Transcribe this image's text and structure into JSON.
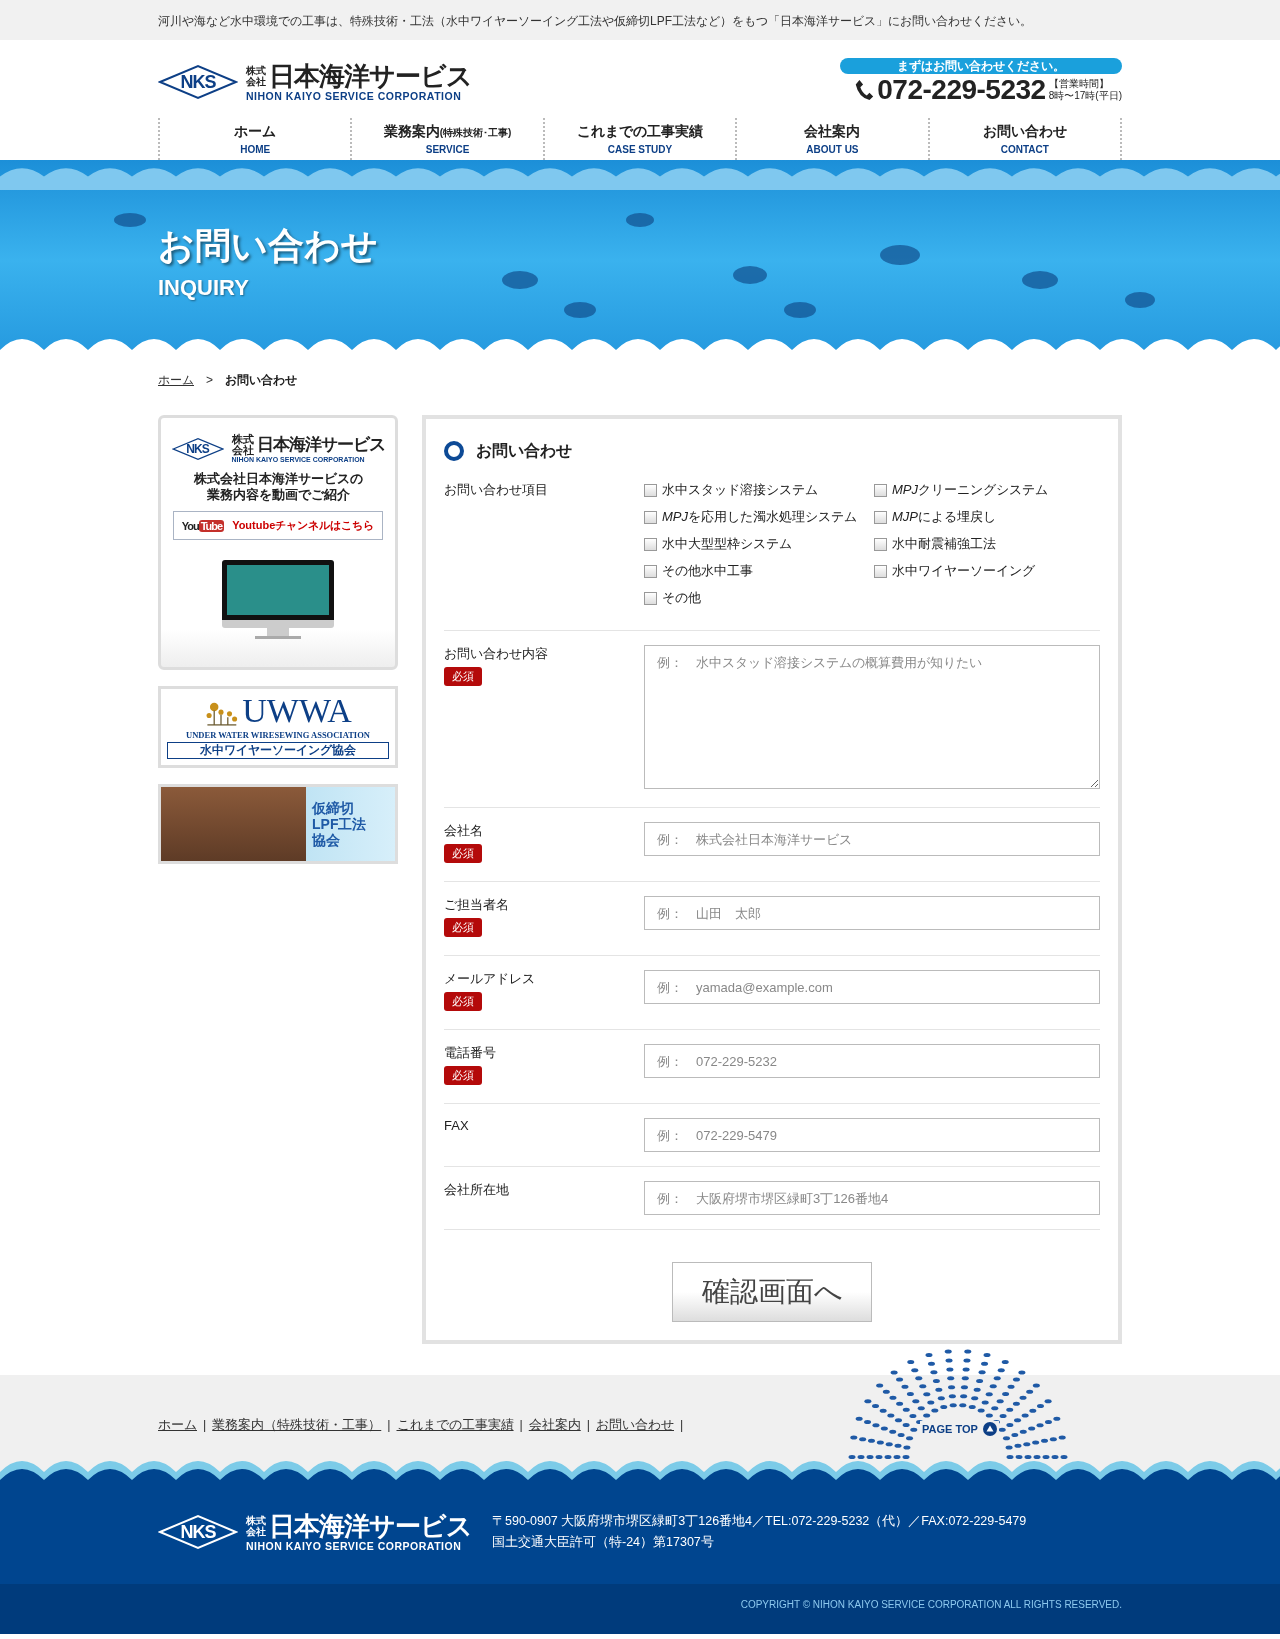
{
  "top_notice": "河川や海など水中環境での工事は、特殊技術・工法（水中ワイヤーソーイング工法や仮締切LPF工法など）をもつ「日本海洋サービス」にお問い合わせください。",
  "header": {
    "logo": {
      "mark": "NKS",
      "prefix": [
        "株式",
        "会社"
      ],
      "name": "日本海洋サービス",
      "romaji": "NIHON KAIYO SERVICE CORPORATION"
    },
    "contact": {
      "banner": "まずはお問い合わせください。",
      "phone": "072-229-5232",
      "hours_label": "【営業時間】",
      "hours": "8時〜17時(平日)"
    }
  },
  "nav": [
    {
      "label": "ホーム",
      "sublabel": "HOME"
    },
    {
      "label": "業務案内",
      "note": "(特殊技術･工事)",
      "sublabel": "SERVICE"
    },
    {
      "label": "これまでの工事実績",
      "sublabel": "CASE STUDY"
    },
    {
      "label": "会社案内",
      "sublabel": "ABOUT US"
    },
    {
      "label": "お問い合わせ",
      "sublabel": "CONTACT"
    }
  ],
  "hero": {
    "title": "お問い合わせ",
    "subtitle": "INQUIRY"
  },
  "breadcrumb": {
    "items": [
      {
        "label": "ホーム",
        "link": true
      },
      {
        "label": "お問い合わせ",
        "link": false
      }
    ],
    "separator": ">"
  },
  "sidebar": {
    "video_card": {
      "logo": {
        "mark": "NKS",
        "prefix": [
          "株式",
          "会社"
        ],
        "name": "日本海洋サービス",
        "romaji": "NIHON KAIYO SERVICE CORPORATION"
      },
      "caption": [
        "株式会社日本海洋サービスの",
        "業務内容を動画でご紹介"
      ],
      "youtube_logo": [
        "You",
        "Tube"
      ],
      "link": "Youtubeチャンネルはこちら"
    },
    "uwwa": {
      "title": "UWWA",
      "subtitle": "UNDER WATER WIRESEWING ASSOCIATION",
      "japanese": "水中ワイヤーソーイング協会"
    },
    "lpf": {
      "lines": [
        "仮締切",
        "LPF工法",
        "協会"
      ]
    }
  },
  "form": {
    "title": "お問い合わせ",
    "fields": [
      {
        "kind": "checkboxes",
        "label": "お問い合わせ項目",
        "options": [
          {
            "label": "水中スタッド溶接システム",
            "checked": false
          },
          {
            "italic_prefix": "MPJ",
            "label": "を応用した濁水処理システム",
            "checked": false
          },
          {
            "label": "水中大型型枠システム",
            "checked": false
          },
          {
            "label": "その他水中工事",
            "checked": false
          },
          {
            "label": "その他",
            "checked": false
          },
          {
            "italic_prefix": "MPJ",
            "label": "クリーニングシステム",
            "checked": false
          },
          {
            "italic_prefix": "MJP",
            "label": "による埋戻し",
            "checked": false
          },
          {
            "label": "水中耐震補強工法",
            "checked": false
          },
          {
            "label": "水中ワイヤーソーイング",
            "checked": false
          }
        ]
      },
      {
        "kind": "textarea",
        "label": "お問い合わせ内容",
        "badge": "必須",
        "placeholder": "例：　水中スタッド溶接システムの概算費用が知りたい"
      },
      {
        "kind": "text",
        "label": "会社名",
        "badge": "必須",
        "placeholder": "例：　株式会社日本海洋サービス"
      },
      {
        "kind": "text",
        "label": "ご担当者名",
        "badge": "必須",
        "placeholder": "例：　山田　太郎"
      },
      {
        "kind": "text",
        "label": "メールアドレス",
        "badge": "必須",
        "placeholder": "例：　yamada@example.com"
      },
      {
        "kind": "text",
        "label": "電話番号",
        "badge": "必須",
        "placeholder": "例：　072-229-5232"
      },
      {
        "kind": "text",
        "label": "FAX",
        "placeholder": "例：　072-229-5479"
      },
      {
        "kind": "text",
        "label": "会社所在地",
        "placeholder": "例：　大阪府堺市堺区緑町3丁126番地4"
      }
    ],
    "submit": "確認画面へ"
  },
  "footer": {
    "links": [
      "ホーム",
      "業務案内（特殊技術・工事）",
      "これまでの工事実績",
      "会社案内",
      "お問い合わせ"
    ],
    "separator": "|",
    "page_top": "PAGE TOP",
    "logo": {
      "mark": "NKS",
      "prefix": [
        "株式",
        "会社"
      ],
      "name": "日本海洋サービス",
      "romaji": "NIHON KAIYO SERVICE CORPORATION"
    },
    "address": "〒590-0907 大阪府堺市堺区緑町3丁126番地4／TEL:072-229-5232（代）／FAX:072-229-5479",
    "license": "国土交通大臣許可（特-24）第17307号",
    "copyright": "COPYRIGHT © NIHON KAIYO SERVICE CORPORATION ALL RIGHTS RESERVED."
  }
}
